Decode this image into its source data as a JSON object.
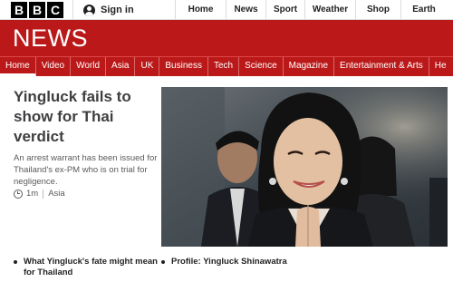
{
  "topbar": {
    "logo_letters": [
      "B",
      "B",
      "C"
    ],
    "signin_icon": "user-icon",
    "signin_label": "Sign in",
    "nav": [
      {
        "label": "Home",
        "width": 56
      },
      {
        "label": "News",
        "width": 44
      },
      {
        "label": "Sport",
        "width": 43
      },
      {
        "label": "Weather",
        "width": 56
      },
      {
        "label": "Shop",
        "width": 50
      },
      {
        "label": "Earth",
        "width": 51
      }
    ]
  },
  "banner": {
    "wordmark": "NEWS",
    "color": "#bb1919"
  },
  "sections": [
    {
      "label": "Home",
      "active": true
    },
    {
      "label": "Video"
    },
    {
      "label": "World"
    },
    {
      "label": "Asia"
    },
    {
      "label": "UK"
    },
    {
      "label": "Business"
    },
    {
      "label": "Tech"
    },
    {
      "label": "Science"
    },
    {
      "label": "Magazine"
    },
    {
      "label": "Entertainment & Arts"
    },
    {
      "label": "He"
    }
  ],
  "story": {
    "headline": "Yingluck fails to show for Thai verdict",
    "summary": "An arrest warrant has been issued for Thailand's ex-PM who is on trial for negligence.",
    "time": "1m",
    "section": "Asia",
    "time_icon": "clock-icon"
  },
  "related": [
    {
      "label": "What Yingluck's fate might mean for Thailand"
    },
    {
      "label": "Profile: Yingluck Shinawatra"
    }
  ]
}
